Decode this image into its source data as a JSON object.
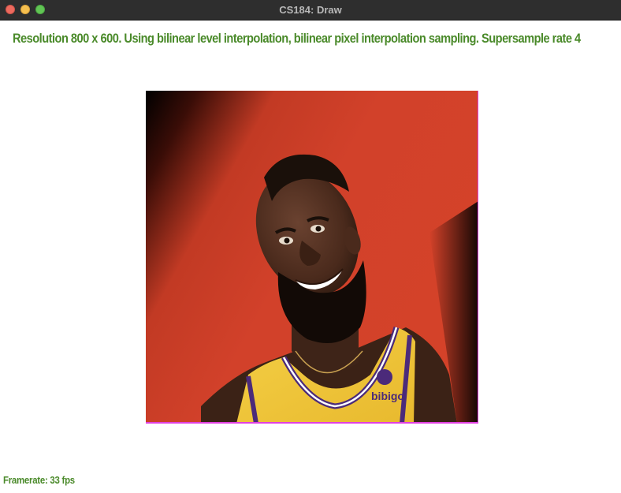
{
  "window": {
    "title": "CS184: Draw"
  },
  "status": {
    "info_text": "Resolution 800 x 600. Using bilinear level interpolation, bilinear pixel interpolation sampling. Supersample rate 4",
    "framerate_text": "Framerate: 33 fps"
  },
  "canvas": {
    "content": "textured-square-portrait",
    "background_color": "#d2402a",
    "border_color": "#e040e0",
    "jersey_logo_text": "bibigo"
  },
  "colors": {
    "status_text": "#4a8a2a",
    "titlebar": "#2e2e2e",
    "title_text": "#b8b8b8"
  }
}
